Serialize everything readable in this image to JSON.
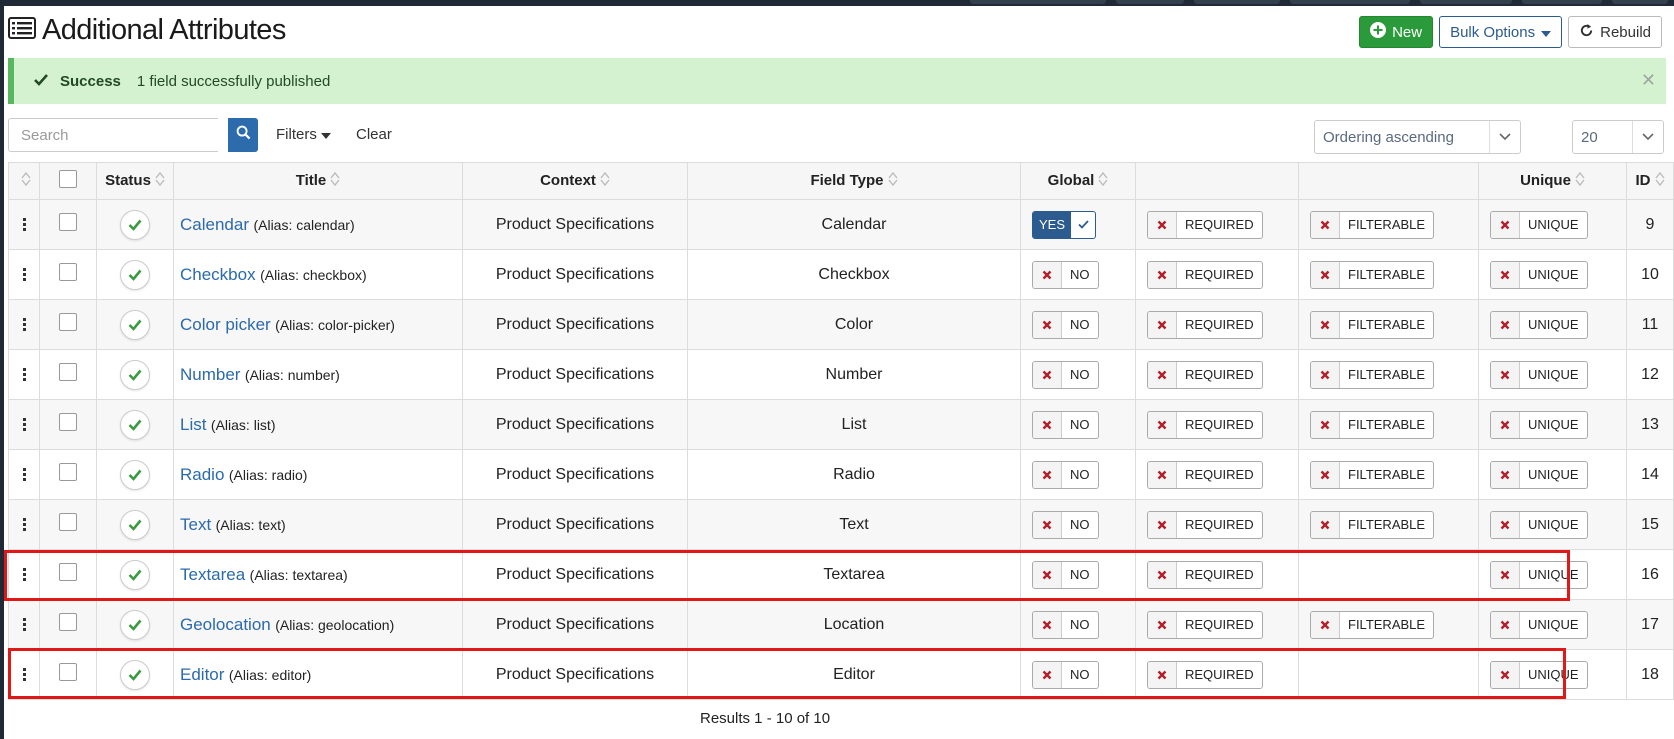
{
  "page": {
    "title": "Additional Attributes"
  },
  "toolbar": {
    "new_label": "New",
    "bulk_label": "Bulk Options",
    "rebuild_label": "Rebuild"
  },
  "alert": {
    "title": "Success",
    "message": "1 field successfully published"
  },
  "filters": {
    "search_placeholder": "Search",
    "filters_label": "Filters",
    "clear_label": "Clear",
    "ordering_value": "Ordering ascending",
    "limit_value": "20"
  },
  "table": {
    "headers": {
      "status": "Status",
      "title": "Title",
      "context": "Context",
      "field_type": "Field Type",
      "global": "Global",
      "unique": "Unique",
      "id": "ID"
    },
    "toggle_labels": {
      "yes": "YES",
      "no": "NO",
      "required": "REQUIRED",
      "filterable": "FILTERABLE",
      "unique": "UNIQUE"
    },
    "rows": [
      {
        "title": "Calendar",
        "alias": "(Alias: calendar)",
        "context": "Product Specifications",
        "field_type": "Calendar",
        "global": "YES",
        "filterable": true,
        "id": "9"
      },
      {
        "title": "Checkbox",
        "alias": "(Alias: checkbox)",
        "context": "Product Specifications",
        "field_type": "Checkbox",
        "global": "NO",
        "filterable": true,
        "id": "10"
      },
      {
        "title": "Color picker",
        "alias": "(Alias: color-picker)",
        "context": "Product Specifications",
        "field_type": "Color",
        "global": "NO",
        "filterable": true,
        "id": "11"
      },
      {
        "title": "Number",
        "alias": "(Alias: number)",
        "context": "Product Specifications",
        "field_type": "Number",
        "global": "NO",
        "filterable": true,
        "id": "12"
      },
      {
        "title": "List",
        "alias": "(Alias: list)",
        "context": "Product Specifications",
        "field_type": "List",
        "global": "NO",
        "filterable": true,
        "id": "13"
      },
      {
        "title": "Radio",
        "alias": "(Alias: radio)",
        "context": "Product Specifications",
        "field_type": "Radio",
        "global": "NO",
        "filterable": true,
        "id": "14"
      },
      {
        "title": "Text",
        "alias": "(Alias: text)",
        "context": "Product Specifications",
        "field_type": "Text",
        "global": "NO",
        "filterable": true,
        "id": "15"
      },
      {
        "title": "Textarea",
        "alias": "(Alias: textarea)",
        "context": "Product Specifications",
        "field_type": "Textarea",
        "global": "NO",
        "filterable": false,
        "id": "16"
      },
      {
        "title": "Geolocation",
        "alias": "(Alias: geolocation)",
        "context": "Product Specifications",
        "field_type": "Location",
        "global": "NO",
        "filterable": true,
        "id": "17"
      },
      {
        "title": "Editor",
        "alias": "(Alias: editor)",
        "context": "Product Specifications",
        "field_type": "Editor",
        "global": "NO",
        "filterable": false,
        "id": "18"
      }
    ]
  },
  "footer": {
    "results": "Results 1 - 10 of 10"
  },
  "colors": {
    "link": "#2b6aab",
    "success_green": "#2a9a3a",
    "alert_bg": "#d4f2d0",
    "highlight_red": "#e01818",
    "x_red": "#b0202a"
  }
}
